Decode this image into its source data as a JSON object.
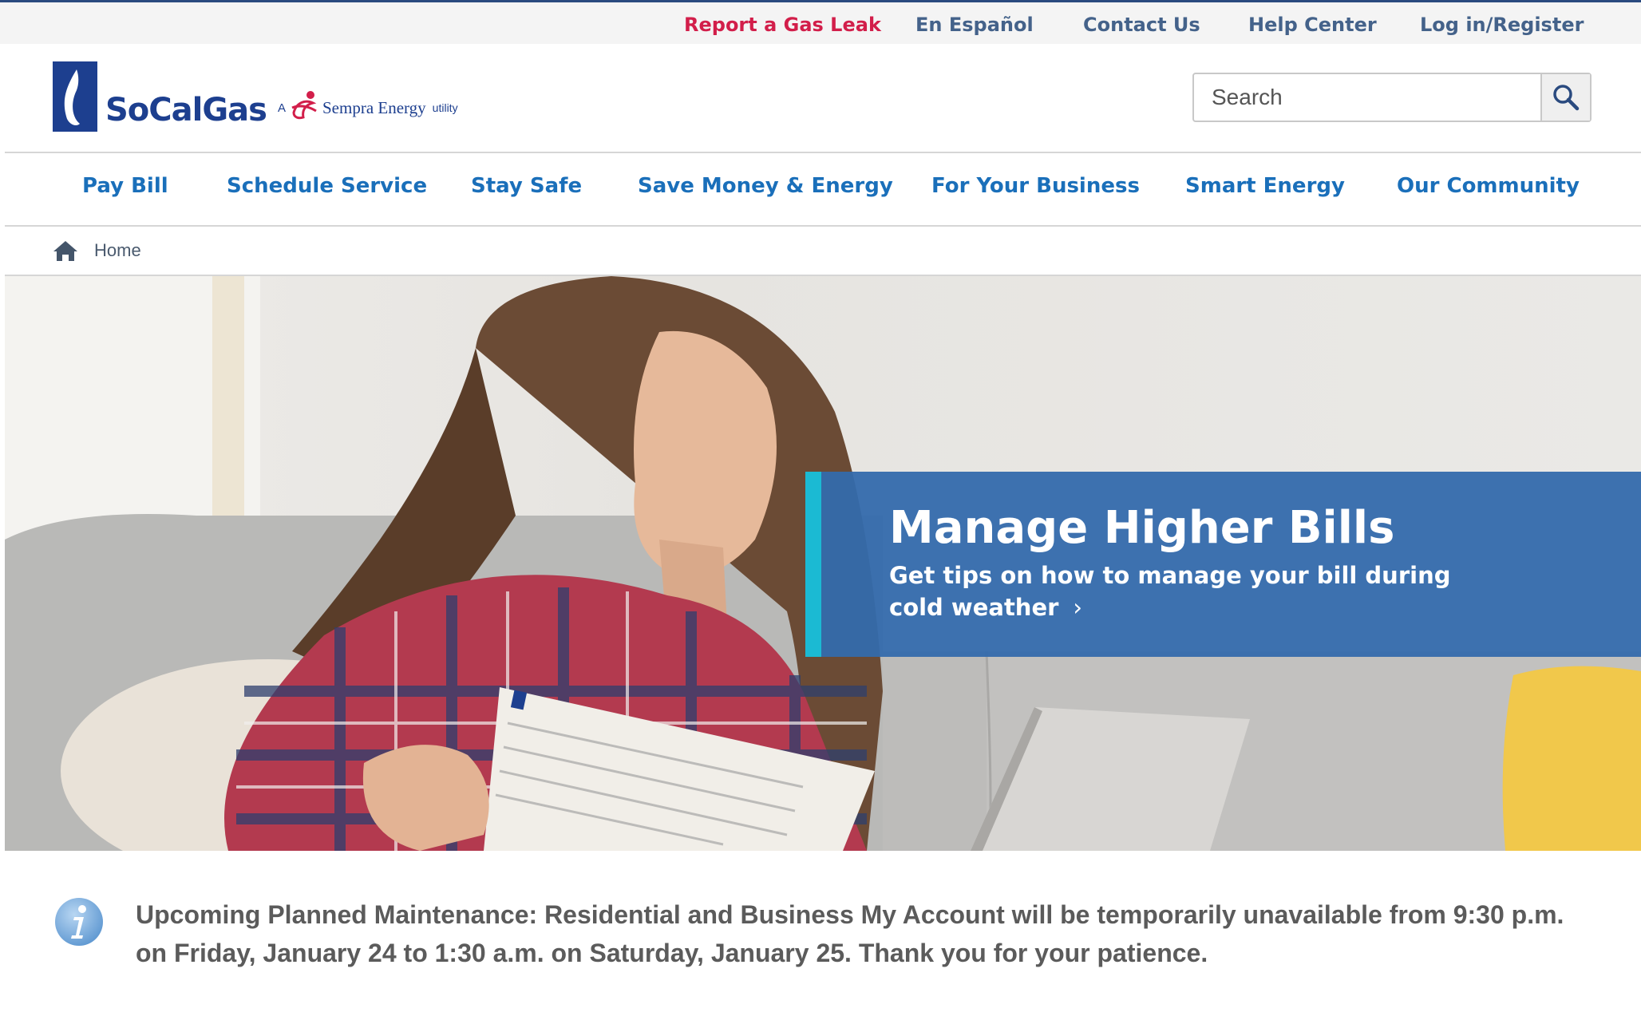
{
  "utility_nav": {
    "report_leak": "Report a Gas Leak",
    "espanol": "En Español",
    "contact": "Contact Us",
    "help": "Help Center",
    "login": "Log in/Register"
  },
  "logo": {
    "wordmark": "SoCalGas",
    "tag_a": "A",
    "tag_company": "Sempra Energy",
    "tag_utility": "utility",
    "brand_color": "#1d3f8f"
  },
  "search": {
    "placeholder": "Search",
    "icon": "magnifier-icon"
  },
  "main_nav": {
    "items": [
      {
        "label": "Pay Bill"
      },
      {
        "label": "Schedule Service"
      },
      {
        "label": "Stay Safe"
      },
      {
        "label": "Save Money & Energy"
      },
      {
        "label": "For Your Business"
      },
      {
        "label": "Smart Energy"
      },
      {
        "label": "Our Community"
      }
    ],
    "color": "#1a6fba"
  },
  "breadcrumb": {
    "home_label": "Home",
    "icon": "home-icon"
  },
  "hero": {
    "promo_title": "Manage Higher Bills",
    "promo_subtitle": "Get tips on how to manage your bill during cold weather",
    "promo_chevron": "›",
    "promo_bg": "#346aac",
    "promo_accent": "#1bbad3"
  },
  "notice": {
    "icon": "info-icon",
    "message": "Upcoming Planned Maintenance: Residential and Business My Account will be temporarily unavailable from 9:30 p.m. on Friday, January 24 to 1:30 a.m. on Saturday, January 25. Thank you for your patience."
  }
}
